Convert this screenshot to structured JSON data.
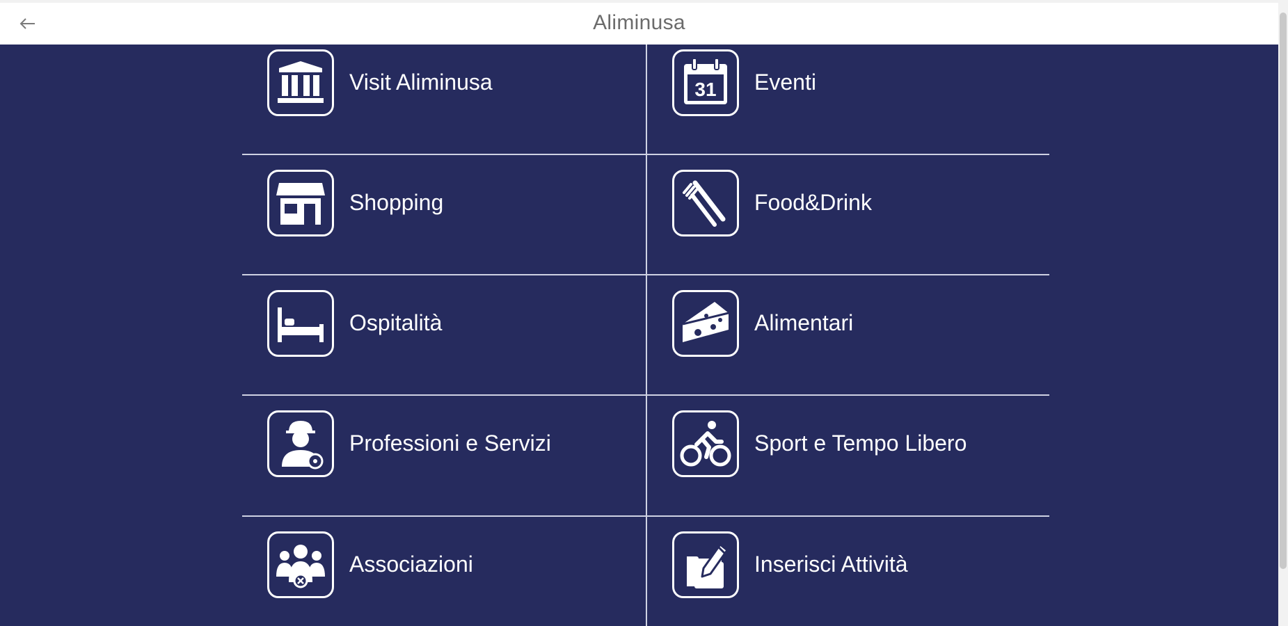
{
  "header": {
    "title": "Aliminusa",
    "back_icon": "arrow-left-icon"
  },
  "colors": {
    "background": "#262b5e",
    "divider": "#cfd2e3",
    "header_bg": "#ffffff",
    "title_text": "#6b6b6b"
  },
  "menu": {
    "items": [
      {
        "label": "Visit Aliminusa",
        "icon": "temple-icon"
      },
      {
        "label": "Eventi",
        "icon": "calendar-icon"
      },
      {
        "label": "Shopping",
        "icon": "shop-icon"
      },
      {
        "label": "Food&Drink",
        "icon": "fork-knife-icon"
      },
      {
        "label": "Ospitalità",
        "icon": "bed-icon"
      },
      {
        "label": "Alimentari",
        "icon": "cheese-icon"
      },
      {
        "label": "Professioni e Servizi",
        "icon": "worker-icon"
      },
      {
        "label": "Sport e Tempo Libero",
        "icon": "cyclist-icon"
      },
      {
        "label": "Associazioni",
        "icon": "people-group-icon"
      },
      {
        "label": "Inserisci Attività",
        "icon": "add-business-icon"
      }
    ],
    "calendar_day": "31"
  }
}
